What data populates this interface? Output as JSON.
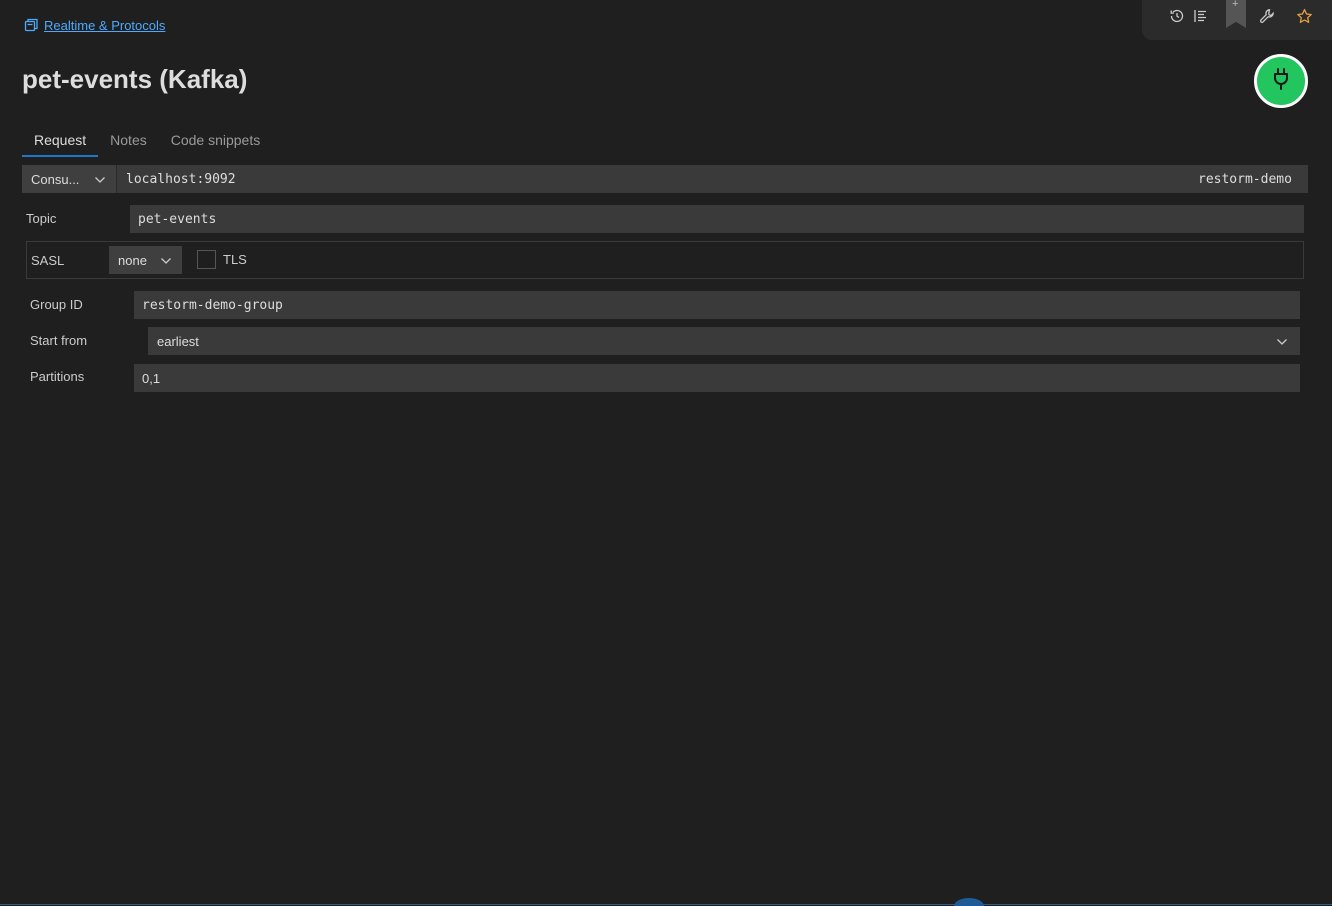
{
  "breadcrumb": {
    "label": "Realtime & Protocols",
    "icon": "folder-stack-icon"
  },
  "toolbar": {
    "icons": [
      "history-icon",
      "list-icon",
      "bookmark-icon",
      "wrench-icon",
      "star-icon"
    ],
    "bookmark_plus": "+",
    "accent": "#e8a23a"
  },
  "title": "pet-events (Kafka)",
  "connect": {
    "icon": "plug-icon",
    "color": "#22c55e"
  },
  "tabs": [
    {
      "label": "Request",
      "active": true
    },
    {
      "label": "Notes",
      "active": false
    },
    {
      "label": "Code snippets",
      "active": false
    }
  ],
  "request": {
    "mode": "Consu...",
    "url": "localhost:9092",
    "environment": "restorm-demo"
  },
  "form": {
    "topic": {
      "label": "Topic",
      "value": "pet-events"
    },
    "sasl": {
      "label": "SASL",
      "value": "none"
    },
    "tls": {
      "label": "TLS",
      "checked": false
    },
    "group_id": {
      "label": "Group ID",
      "value": "restorm-demo-group"
    },
    "start_from": {
      "label": "Start from",
      "value": "earliest"
    },
    "partitions": {
      "label": "Partitions",
      "value": "0,1"
    }
  }
}
